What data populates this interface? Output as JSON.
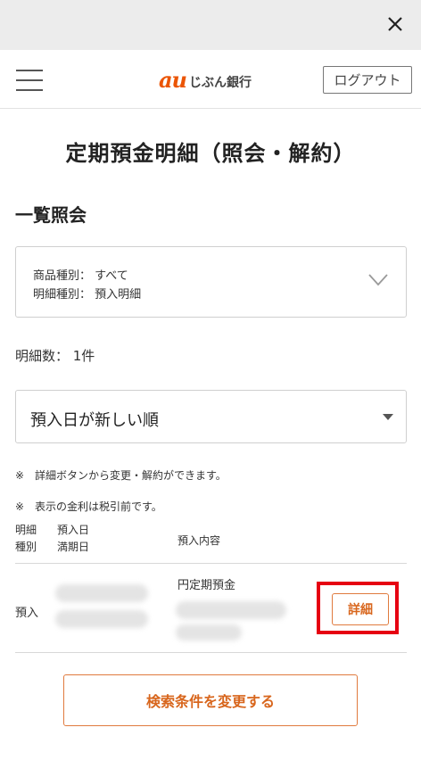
{
  "window": {
    "close_icon": "close-icon"
  },
  "header": {
    "logo_au": "au",
    "logo_bank": "じぶん銀行",
    "logout_label": "ログアウト",
    "menu_icon": "hamburger-icon"
  },
  "page": {
    "title": "定期預金明細（照会・解約）",
    "section_title": "一覧照会"
  },
  "filter": {
    "line1": "商品種別： すべて",
    "line2": "明細種別： 預入明細",
    "icon": "chevron-down-icon"
  },
  "count_text": "明細数： 1件",
  "sort": {
    "selected": "預入日が新しい順",
    "icon": "caret-down-icon"
  },
  "notes": [
    {
      "mark": "※",
      "text": "詳細ボタンから変更・解約ができます。"
    },
    {
      "mark": "※",
      "text": "表示の金利は税引前です。"
    }
  ],
  "table": {
    "headers": {
      "col1_line1": "明細",
      "col1_line2": "種別",
      "col2_line1": "預入日",
      "col2_line2": "満期日",
      "col3": "預入内容"
    },
    "rows": [
      {
        "type": "預入",
        "product": "円定期預金",
        "detail_label": "詳細"
      }
    ]
  },
  "change_button_label": "検索条件を変更する",
  "colors": {
    "accent": "#d8661d",
    "brand": "#eb5505",
    "highlight": "#e60012"
  }
}
